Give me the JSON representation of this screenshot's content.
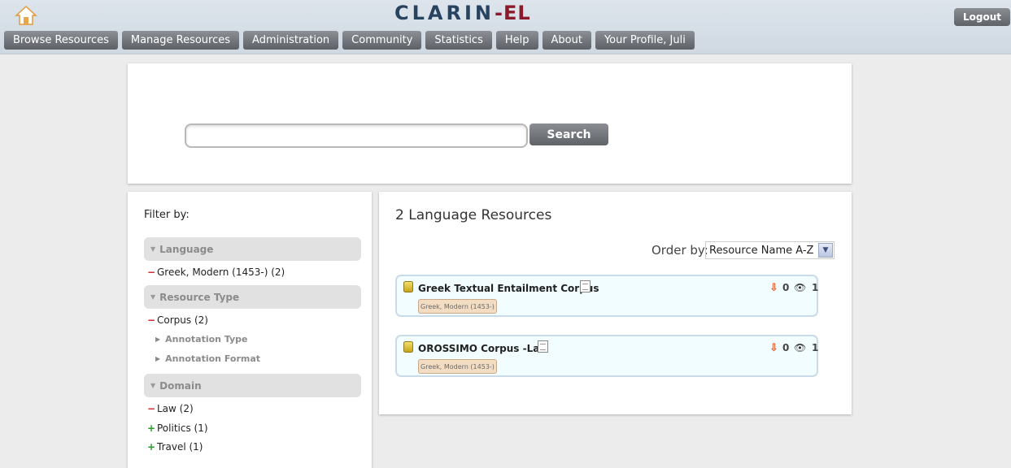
{
  "header": {
    "logo_part1": "CLARIN",
    "logo_part2": "-EL",
    "logout_label": "Logout"
  },
  "nav": [
    {
      "label": "Browse Resources"
    },
    {
      "label": "Manage Resources"
    },
    {
      "label": "Administration"
    },
    {
      "label": "Community"
    },
    {
      "label": "Statistics"
    },
    {
      "label": "Help"
    },
    {
      "label": "About"
    },
    {
      "label": "Your Profile, Juli"
    }
  ],
  "search": {
    "value": "",
    "button_label": "Search"
  },
  "filter": {
    "title": "Filter by:",
    "language_header": "Language",
    "language_item": "Greek, Modern (1453-) (2)",
    "resource_type_header": "Resource Type",
    "resource_type_item": "Corpus (2)",
    "annotation_type": "Annotation Type",
    "annotation_format": "Annotation Format",
    "domain_header": "Domain",
    "domain_items": [
      {
        "label": "Law (2)",
        "state": "selected"
      },
      {
        "label": "Politics (1)",
        "state": "add"
      },
      {
        "label": "Travel (1)",
        "state": "add"
      }
    ]
  },
  "results": {
    "count_label": "2 Language Resources",
    "order_label": "Order by:",
    "order_value": "Resource Name A-Z",
    "items": [
      {
        "name": "Greek Textual Entailment Corpus",
        "tag": "Greek, Modern (1453-)",
        "downloads": "0",
        "views": "1"
      },
      {
        "name": "OROSSIMO Corpus -Law",
        "tag": "Greek, Modern (1453-)",
        "downloads": "0",
        "views": "1"
      }
    ]
  },
  "icons": {
    "home": "home-icon",
    "resource": "database-icon",
    "document": "document-icon",
    "download": "download-icon",
    "views": "eye-icon"
  },
  "colors": {
    "logo_primary": "#27435f",
    "logo_accent": "#8b1a2a",
    "button_gray": "#6f7378",
    "card_bg": "#f1fdfe"
  }
}
